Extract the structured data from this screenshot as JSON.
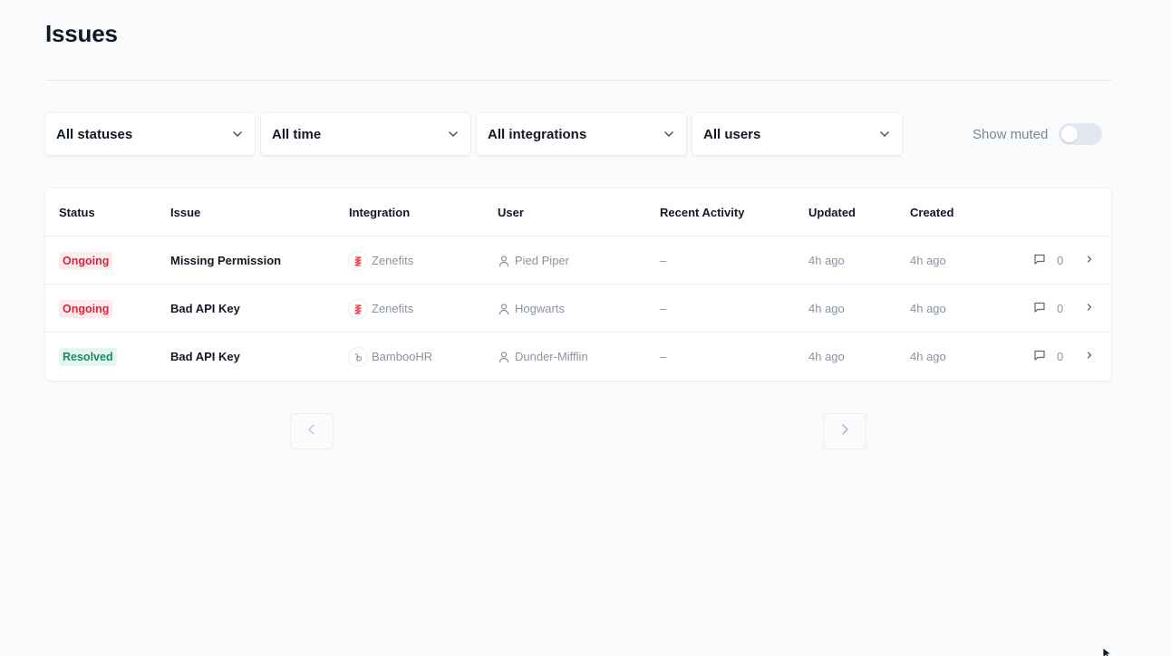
{
  "page": {
    "title": "Issues"
  },
  "filters": {
    "status": "All statuses",
    "time": "All time",
    "integrations": "All integrations",
    "users": "All users",
    "show_muted_label": "Show muted",
    "show_muted_on": false
  },
  "table": {
    "columns": {
      "status": "Status",
      "issue": "Issue",
      "integration": "Integration",
      "user": "User",
      "recent_activity": "Recent Activity",
      "updated": "Updated",
      "created": "Created"
    },
    "rows": [
      {
        "status": "Ongoing",
        "issue": "Missing Permission",
        "integration": "Zenefits",
        "user": "Pied Piper",
        "recent_activity": "–",
        "updated": "4h ago",
        "created": "4h ago",
        "comments": "0"
      },
      {
        "status": "Ongoing",
        "issue": "Bad API Key",
        "integration": "Zenefits",
        "user": "Hogwarts",
        "recent_activity": "–",
        "updated": "4h ago",
        "created": "4h ago",
        "comments": "0"
      },
      {
        "status": "Resolved",
        "issue": "Bad API Key",
        "integration": "BambooHR",
        "user": "Dunder-Mifflin",
        "recent_activity": "–",
        "updated": "4h ago",
        "created": "4h ago",
        "comments": "0"
      }
    ]
  },
  "colors": {
    "ongoing_text": "#d7263d",
    "ongoing_bg": "#fdecee",
    "resolved_text": "#1d8a63",
    "resolved_bg": "#e3f6ef",
    "zenefits_brand": "#e8434f",
    "bamboohr_brand": "#8a93a3"
  },
  "icons": {
    "dropdown": "chevron-down-icon",
    "user": "user-icon",
    "comment": "comment-icon",
    "row_link": "chevron-right-icon",
    "prev": "chevron-left-icon",
    "next": "chevron-right-icon"
  }
}
